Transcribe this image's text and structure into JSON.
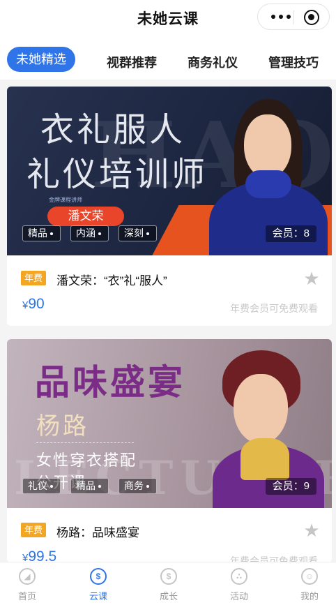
{
  "header": {
    "title": "未她云课",
    "more_icon": "more-dots-icon",
    "close_icon": "target-close-icon"
  },
  "tabs": [
    {
      "label": "未她精选",
      "active": true
    },
    {
      "label": "视群推荐",
      "active": false
    },
    {
      "label": "商务礼仪",
      "active": false
    },
    {
      "label": "管理技巧",
      "active": false
    }
  ],
  "courses": [
    {
      "banner": {
        "headline_line1": "衣礼服人",
        "headline_line2": "礼仪培训师",
        "caption": "金牌课程讲师",
        "lecturer_name": "潘文荣",
        "watermark": "HAOLE",
        "tags": [
          "精品",
          "内涵",
          "深刻"
        ],
        "member_label": "会员：8"
      },
      "badge": "年费",
      "title": "潘文荣：“衣”礼“服人”",
      "price_currency": "¥",
      "price_value": "90",
      "free_note": "年费会员可免费观看",
      "favorite_icon": "star-icon"
    },
    {
      "banner": {
        "headline_line1": "品味盛宴",
        "lecturer_name": "杨路",
        "subline1": "女性穿衣搭配",
        "subline2": "公开课",
        "watermark": "LECTURER",
        "tags": [
          "礼仪",
          "精品",
          "商务"
        ],
        "member_label": "会员：9"
      },
      "badge": "年费",
      "title": "杨路：品味盛宴",
      "price_currency": "¥",
      "price_value": "99.5",
      "free_note": "年费会员可免费观看",
      "favorite_icon": "star-icon"
    }
  ],
  "nav": [
    {
      "label": "首页",
      "icon": "compass-icon",
      "active": false
    },
    {
      "label": "云课",
      "icon": "cloud-course-icon",
      "active": true
    },
    {
      "label": "成长",
      "icon": "growth-icon",
      "active": false
    },
    {
      "label": "活动",
      "icon": "activity-icon",
      "active": false
    },
    {
      "label": "我的",
      "icon": "profile-icon",
      "active": false
    }
  ],
  "colors": {
    "accent": "#2f74e8",
    "badge": "#f2a623",
    "banner_orange": "#e6531f",
    "headline_purple": "#7b2c86"
  }
}
